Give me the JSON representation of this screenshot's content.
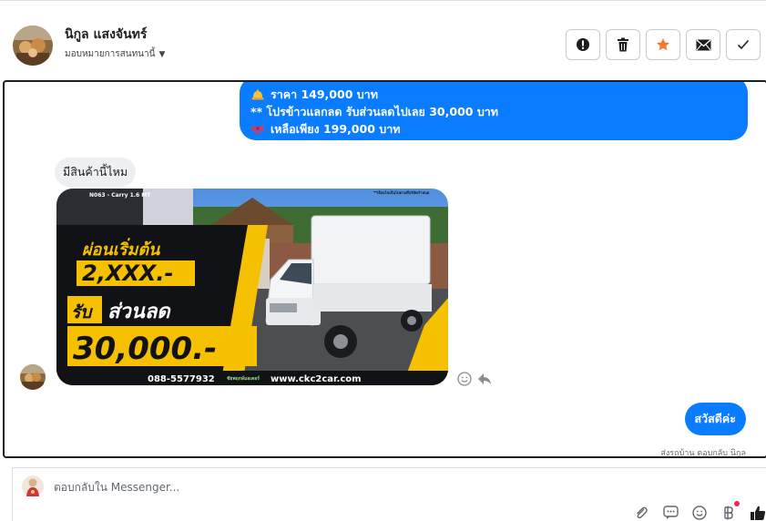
{
  "header": {
    "contact_name": "นิกูล แสงจันทร์",
    "assign_label": "มอบหมายการสนทนานี้",
    "actions": [
      {
        "name": "report-button",
        "icon": "alert-icon"
      },
      {
        "name": "delete-button",
        "icon": "trash-icon"
      },
      {
        "name": "star-button",
        "icon": "star-icon",
        "color": "#f4792a"
      },
      {
        "name": "mark-unread-button",
        "icon": "envelope-icon"
      },
      {
        "name": "done-button",
        "icon": "check-icon"
      }
    ]
  },
  "thread": {
    "outgoing_card": {
      "line1": "ราคา 149,000 บาท",
      "line2": "** โปรข้าวแลกลด รับส่วนลดไปเลย 30,000 บาท",
      "line3": "เหลือเพียง 199,000 บาท"
    },
    "incoming_text": "มีสินค้านี้ไหม",
    "ad_image": {
      "model": "N063 - Carry 1.6 MT",
      "fine_print": "**เงื่อนไขเป็นไปตามที่บริษัทกำหนด",
      "headline1": "ผ่อนเริ่มต้น",
      "amount1": "2,XXX.-",
      "headline2_box": "รับ",
      "headline2": "ส่วนลด",
      "amount2": "30,000.-",
      "phone": "088-5577932",
      "brand": "ชัยพฤกษ์มอเตอร์",
      "website": "www.ckc2car.com"
    },
    "outgoing_reply": "สวัสดีค่ะ",
    "seen_note": "ส่งรถบ้าน ตอบกลับ นิกูล"
  },
  "composer": {
    "placeholder": "ตอบกลับใน Messenger..."
  },
  "colors": {
    "messenger_blue": "#0a7cff",
    "accent_yellow": "#f5c000"
  }
}
